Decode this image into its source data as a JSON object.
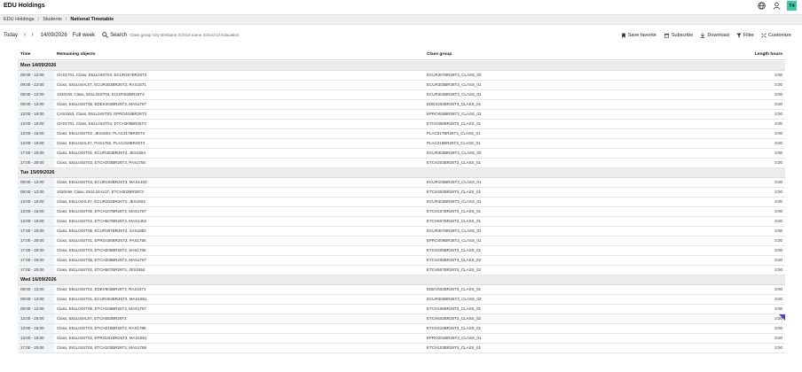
{
  "app": {
    "title": "EDU Holdings",
    "avatar_initials": "T4"
  },
  "breadcrumb": {
    "items": [
      "EDU Holdings",
      "Students"
    ],
    "current": "National Timetable"
  },
  "toolbar": {
    "today": "Today",
    "date": "14/09/2026",
    "view": "Full week",
    "search_label": "Search",
    "search_text": "Class group City Brisbane School name School of Education",
    "actions": {
      "save_favorite": "Save favorite",
      "subscribe": "Subscribe",
      "download": "Download",
      "filter": "Filter",
      "customize": "Customize"
    }
  },
  "table": {
    "headers": {
      "time": "Time",
      "objects": "Remaining objects",
      "class_group": "Class group",
      "length": "Length hours"
    },
    "groups": [
      {
        "label": "Mon 14/09/2026",
        "rows": [
          {
            "time": "09:00 - 12:00",
            "objects": "CHS1701, Class, E61L04ST04, ECUR207BR26T3",
            "class_group": "ECUR207BR26T3_CLASS_02",
            "length": "3:00"
          },
          {
            "time": "09:00 - 12:00",
            "objects": "Class, E61L04AL07, ECUR303BR26T3, RAS1571",
            "class_group": "ECUR303BR26T3_CLASS_01",
            "length": "3:00"
          },
          {
            "time": "09:00 - 12:00",
            "objects": "1020AW, Class, E61L04ST02, ECUR402BR26T3",
            "class_group": "ECUR402BR26T3_CLASS_01",
            "length": "3:00"
          },
          {
            "time": "09:00 - 12:00",
            "objects": "Class, E61L04ST06, EDEX202BR26T3, MAS1787",
            "class_group": "EDEX202BR26T3_CLASS_01",
            "length": "3:00"
          },
          {
            "time": "13:00 - 16:00",
            "objects": "CAS1553, Class, E61L04ST03, EPRO403BR26T3",
            "class_group": "EPRO403BR26T3_CLASS_01",
            "length": "3:00"
          },
          {
            "time": "13:00 - 16:00",
            "objects": "CHS1701, Class, E61L04ST04, ETCH306BR26T3",
            "class_group": "ETCH306BR26T3_CLASS_01",
            "length": "3:00"
          },
          {
            "time": "13:00 - 16:00",
            "objects": "Class, E61L04ST02, JES1504, PLAC317BR26T3",
            "class_group": "PLAC317BR26T3_CLASS_01",
            "length": "3:00"
          },
          {
            "time": "13:00 - 16:00",
            "objects": "Class, E61L04AL07, PAS1755, PLAC318BR26T3",
            "class_group": "PLAC318BR26T3_CLASS_01",
            "length": "3:00"
          },
          {
            "time": "17:00 - 20:00",
            "objects": "Class, E61L04ST01, ECUR303BR26T3, JES1554",
            "class_group": "ECUR303BR26T3_CLASS_02",
            "length": "3:00"
          },
          {
            "time": "17:00 - 20:00",
            "objects": "Class, E61L04ST03, ETCH203BR26T3, PAS1755",
            "class_group": "ETCH203BR26T3_CLASS_01",
            "length": "3:00"
          }
        ]
      },
      {
        "label": "Tue 15/09/2026",
        "rows": [
          {
            "time": "09:00 - 12:00",
            "objects": "Class, E61L04ST03, ECUR103BR26T3, MAS1452",
            "class_group": "ECUR103BR26T3_CLASS_01",
            "length": "3:00"
          },
          {
            "time": "09:00 - 12:00",
            "objects": "1020AW, Class, E61L04AL07, ETCH302BR26T3",
            "class_group": "ETCH302BR26T3_CLASS_01",
            "length": "3:00"
          },
          {
            "time": "13:00 - 16:00",
            "objects": "Class, E61L04AL07, ECUR302BR26T3, JES1504",
            "class_group": "ECUR302BR26T3_CLASS_01",
            "length": "3:00"
          },
          {
            "time": "13:00 - 16:00",
            "objects": "Class, E61L04ST06, ETCH107BR26T3, MAS1787",
            "class_group": "ETCH107BR26T3_CLASS_01",
            "length": "3:00"
          },
          {
            "time": "13:00 - 16:00",
            "objects": "Class, E61L04ST02, ETCH507BR26T3, MAS1452",
            "class_group": "ETCH507BR26T3_CLASS_01",
            "length": "3:00"
          },
          {
            "time": "17:00 - 20:00",
            "objects": "Class, E61L04ST05, ECUR307BR26T3, SAS1882",
            "class_group": "ECUR307BR26T3_CLASS_01",
            "length": "3:00"
          },
          {
            "time": "17:00 - 20:00",
            "objects": "Class, E61L04ST01, EPRO406BR26T3, PAS1755",
            "class_group": "EPRO406BR26T3_CLASS_01",
            "length": "3:00"
          },
          {
            "time": "17:00 - 20:00",
            "objects": "Class, E61L04ST03, ETCH205BR26T3, SHS1766",
            "class_group": "ETCH205BR26T3_CLASS_01",
            "length": "3:00"
          },
          {
            "time": "17:00 - 20:00",
            "objects": "Class, E61L04ST06, ETCH205BR26T3, MAS1787",
            "class_group": "ETCH205BR26T3_CLASS_02",
            "length": "3:00"
          },
          {
            "time": "17:00 - 20:00",
            "objects": "Class, E61L04ST02, ETCH507BR26T3, JES1554",
            "class_group": "ETCH507BR26T3_CLASS_02",
            "length": "3:00"
          }
        ]
      },
      {
        "label": "Wed 16/09/2026",
        "rows": [
          {
            "time": "09:00 - 12:00",
            "objects": "Class, E61L04ST02, EDEV502BR26T3, RAS1571",
            "class_group": "EDEV502BR26T3_CLASS_01",
            "length": "3:00"
          },
          {
            "time": "09:00 - 12:00",
            "objects": "Class, E61L04ST01, ECUR303BR26T3, MAS1851",
            "class_group": "ECUR303BR26T3_CLASS_02",
            "length": "3:00"
          },
          {
            "time": "09:00 - 12:00",
            "objects": "Class, E61L04ST06, ETCH106BR26T3, MAS1787",
            "class_group": "ETCH106BR26T3_CLASS_01",
            "length": "3:00"
          },
          {
            "time": "13:00 - 16:00",
            "objects": "Class, E61L04AL07, ETCH502BR26T3",
            "class_group": "ETCH502BR26T3_CLASS_02",
            "length": "3:00"
          },
          {
            "time": "13:00 - 16:00",
            "objects": "Class, E61L04ST03, ETCH210BR26T3, RAS1788",
            "class_group": "ETCH210BR26T3_CLASS_01",
            "length": "3:00"
          },
          {
            "time": "13:00 - 16:00",
            "objects": "Class, E61L04ST02, EPRO201BR26T3, MAS1851",
            "class_group": "EPRO201BR26T3_CLASS_01",
            "length": "3:00"
          },
          {
            "time": "17:00 - 20:00",
            "objects": "Class, E61L04ST03, ETCH103BR26T3, MAS1788",
            "class_group": "ETCH103BR26T3_CLASS_01",
            "length": "3:00"
          }
        ]
      }
    ]
  }
}
